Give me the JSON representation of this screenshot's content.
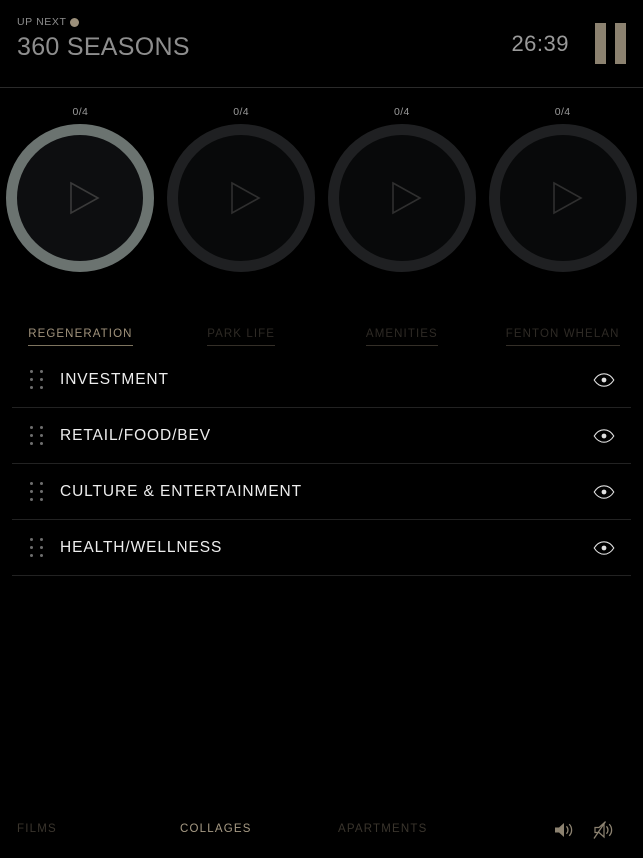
{
  "header": {
    "up_next_label": "UP NEXT",
    "up_next_dot": "status-dot",
    "title": "360 SEASONS",
    "timecode": "26:39",
    "pause_label": "pause-button",
    "accent_color": "#9b8f7a",
    "title_color": "#8e8e8e"
  },
  "circles": [
    {
      "count": "0/4",
      "active": true,
      "name": "regeneration"
    },
    {
      "count": "0/4",
      "active": false,
      "name": "park-life"
    },
    {
      "count": "0/4",
      "active": false,
      "name": "amenities"
    },
    {
      "count": "0/4",
      "active": false,
      "name": "fenton-whelan"
    }
  ],
  "tabs": [
    {
      "label": "REGENERATION",
      "active": true
    },
    {
      "label": "PARK LIFE",
      "active": false
    },
    {
      "label": "AMENITIES",
      "active": false
    },
    {
      "label": "FENTON WHELAN",
      "active": false
    }
  ],
  "list": {
    "rows": [
      {
        "label": "INVESTMENT",
        "drag": "drag-handle",
        "visibility": "eye-icon"
      },
      {
        "label": "RETAIL/FOOD/BEV",
        "drag": "drag-handle",
        "visibility": "eye-icon"
      },
      {
        "label": "CULTURE & ENTERTAINMENT",
        "drag": "drag-handle",
        "visibility": "eye-icon"
      },
      {
        "label": "HEALTH/WELLNESS",
        "drag": "drag-handle",
        "visibility": "eye-icon"
      }
    ]
  },
  "bottom_nav": {
    "items": [
      {
        "label": "FILMS",
        "active": false
      },
      {
        "label": "COLLAGES",
        "active": true
      },
      {
        "label": "APARTMENTS",
        "active": false
      }
    ],
    "audio": {
      "unmute_icon": "speaker-on-icon",
      "mute_icon": "speaker-muted-icon"
    },
    "active_color": "#a69a84",
    "inactive_color": "#3a352d"
  }
}
